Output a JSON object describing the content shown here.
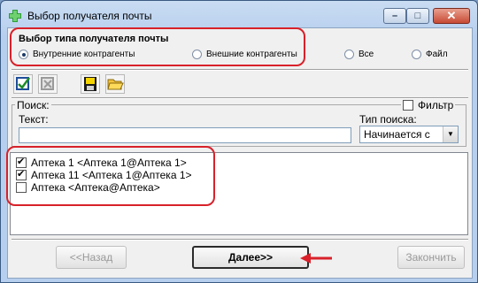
{
  "window": {
    "title": "Выбор получателя почты",
    "controls": {
      "minimize": "–",
      "maximize": "□",
      "close": "✕"
    }
  },
  "recipient_type": {
    "title": "Выбор типа получателя почты",
    "options": [
      {
        "label": "Внутренние контрагенты",
        "selected": true
      },
      {
        "label": "Внешние контрагенты",
        "selected": false
      },
      {
        "label": "Все",
        "selected": false
      },
      {
        "label": "Файл",
        "selected": false
      }
    ]
  },
  "toolbar": {
    "icons": [
      "check-all-icon",
      "uncheck-all-icon",
      "save-icon",
      "open-folder-icon"
    ]
  },
  "search": {
    "group_label": "Поиск:",
    "filter_label": "Фильтр",
    "filter_checked": false,
    "text_label": "Текст:",
    "text_value": "",
    "type_label": "Тип поиска:",
    "type_value": "Начинается с"
  },
  "recipients": [
    {
      "label": "Аптека 1 <Аптека 1@Аптека 1>",
      "checked": true
    },
    {
      "label": "Аптека 11 <Аптека 1@Аптека 1>",
      "checked": true
    },
    {
      "label": "Аптека <Аптека@Аптека>",
      "checked": false
    }
  ],
  "buttons": {
    "back": "<<Назад",
    "next": "Далее>>",
    "finish": "Закончить"
  },
  "colors": {
    "annotation": "#d8212a",
    "title_bar": "#b9d1ea",
    "close": "#c74a34"
  }
}
